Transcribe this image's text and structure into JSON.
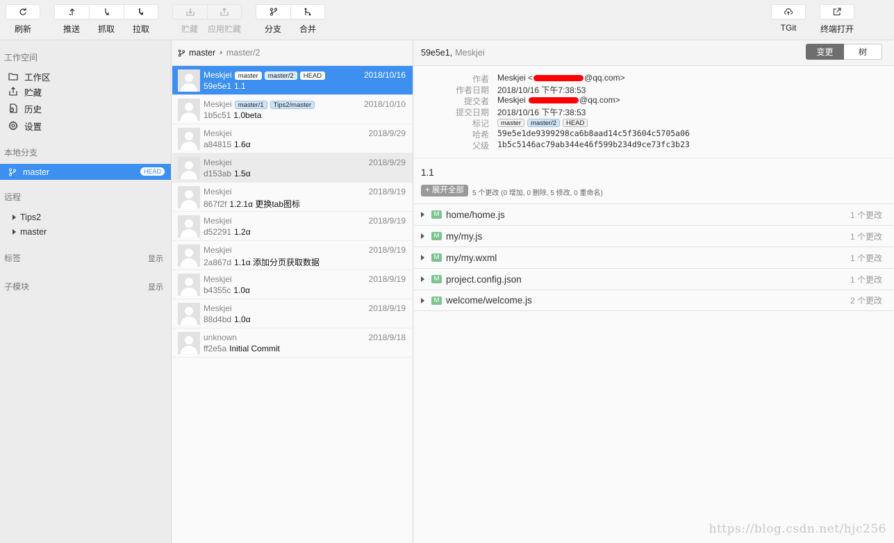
{
  "toolbar": {
    "refresh": "刷新",
    "push": "推送",
    "fetch": "抓取",
    "pull": "拉取",
    "stash": "贮藏",
    "apply_stash": "应用贮藏",
    "branch": "分支",
    "merge": "合并",
    "tgit": "TGit",
    "terminal": "终端打开"
  },
  "sidebar": {
    "workspace_title": "工作空间",
    "workspace_items": [
      {
        "label": "工作区",
        "icon": "folder-icon"
      },
      {
        "label": "贮藏",
        "icon": "stash-icon"
      },
      {
        "label": "历史",
        "icon": "history-icon"
      },
      {
        "label": "设置",
        "icon": "gear-icon"
      }
    ],
    "local_title": "本地分支",
    "local_branch": {
      "label": "master",
      "badge": "HEAD"
    },
    "remote_title": "远程",
    "remotes": [
      "Tips2",
      "master"
    ],
    "tags_title": "标签",
    "tags_action": "显示",
    "submodules_title": "子模块",
    "submodules_action": "显示"
  },
  "commit_list": {
    "branch": "master",
    "separator": "›",
    "compare": "master/2",
    "commits": [
      {
        "author": "Meskjei",
        "date": "2018/10/16",
        "hash": "59e5e1",
        "message": "1.1",
        "tags": [
          {
            "text": "master",
            "style": "gray"
          },
          {
            "text": "master/2",
            "style": "blue"
          },
          {
            "text": "HEAD",
            "style": "gray"
          }
        ]
      },
      {
        "author": "Meskjei",
        "date": "2018/10/10",
        "hash": "1b5c51",
        "message": "1.0beta",
        "tags": [
          {
            "text": "master/1",
            "style": "blue"
          },
          {
            "text": "Tips2/master",
            "style": "blue"
          }
        ]
      },
      {
        "author": "Meskjei",
        "date": "2018/9/29",
        "hash": "a84815",
        "message": "1.6α",
        "tags": []
      },
      {
        "author": "Meskjei",
        "date": "2018/9/29",
        "hash": "d153ab",
        "message": "1.5α",
        "tags": []
      },
      {
        "author": "Meskjei",
        "date": "2018/9/19",
        "hash": "867f2f",
        "message": "1.2.1α 更换tab图标",
        "tags": []
      },
      {
        "author": "Meskjei",
        "date": "2018/9/19",
        "hash": "d52291",
        "message": "1.2α",
        "tags": []
      },
      {
        "author": "Meskjei",
        "date": "2018/9/19",
        "hash": "2a867d",
        "message": "1.1α 添加分页获取数据",
        "tags": []
      },
      {
        "author": "Meskjei",
        "date": "2018/9/19",
        "hash": "b4355c",
        "message": "1.0α",
        "tags": []
      },
      {
        "author": "Meskjei",
        "date": "2018/9/19",
        "hash": "88d4bd",
        "message": "1.0α",
        "tags": []
      },
      {
        "author": "unknown",
        "date": "2018/9/18",
        "hash": "ff2e5a",
        "message": "Initial Commit",
        "tags": []
      }
    ]
  },
  "detail": {
    "hash_short": "59e5e1,",
    "author_short": "Meskjei",
    "tab_changes": "变更",
    "tab_tree": "树",
    "fields": {
      "author_label": "作者",
      "author_name": "Meskjei <",
      "author_email_suffix": "@qq.com>",
      "author_date_label": "作者日期",
      "author_date": "2018/10/16 下午7:38:53",
      "committer_label": "提交者",
      "committer_name": "Meskjei",
      "committer_email_suffix": "@qq.com>",
      "commit_date_label": "提交日期",
      "commit_date": "2018/10/16 下午7:38:53",
      "refs_label": "标记",
      "refs": [
        {
          "text": "master",
          "style": "gray"
        },
        {
          "text": "master/2",
          "style": "blue"
        },
        {
          "text": "HEAD",
          "style": "gray"
        }
      ],
      "hash_label": "哈希",
      "hash": "59e5e1de9399298ca6b8aad14c5f3604c5705a06",
      "parent_label": "父级",
      "parent": "1b5c5146ac79ab344e46f599b234d9ce73fc3b23"
    },
    "subject": "1.1",
    "expand_label": "+ 展开全部",
    "summary": "5 个更改 (0 增加, 0 删除, 5 修改, 0 重命名)",
    "files": [
      {
        "status": "M",
        "path": "home/home.js",
        "changes": "1 个更改"
      },
      {
        "status": "M",
        "path": "my/my.js",
        "changes": "1 个更改"
      },
      {
        "status": "M",
        "path": "my/my.wxml",
        "changes": "1 个更改"
      },
      {
        "status": "M",
        "path": "project.config.json",
        "changes": "1 个更改"
      },
      {
        "status": "M",
        "path": "welcome/welcome.js",
        "changes": "2 个更改"
      }
    ]
  },
  "watermark": "https://blog.csdn.net/hjc256",
  "colors": {
    "accent": "#3d8ff0",
    "modified_badge": "#7cc38f",
    "redaction": "#ff0000"
  }
}
